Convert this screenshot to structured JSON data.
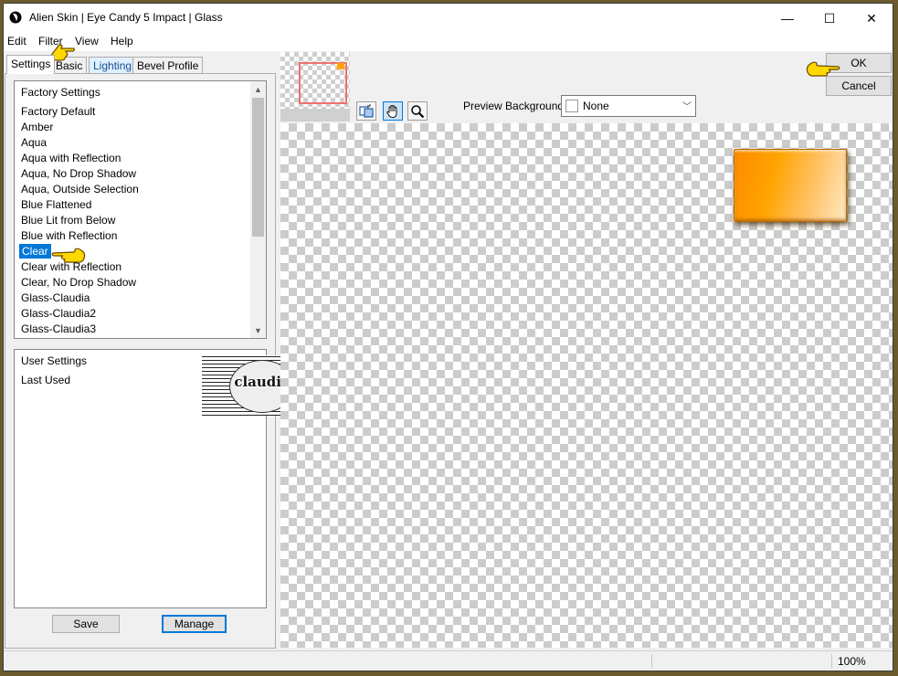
{
  "window": {
    "title": "Alien Skin | Eye Candy 5 Impact | Glass"
  },
  "titlebar_buttons": {
    "minimize": "—",
    "maximize": "☐",
    "close": "✕"
  },
  "menu": [
    "Edit",
    "Filter",
    "View",
    "Help"
  ],
  "tabs": [
    {
      "label": "Settings",
      "active": true
    },
    {
      "label": "Basic",
      "active": false
    },
    {
      "label": "Lighting",
      "active": false
    },
    {
      "label": "Bevel Profile",
      "active": false
    }
  ],
  "preset_list": {
    "items": [
      "Factory Settings",
      "Factory Default",
      "Amber",
      "Aqua",
      "Aqua with Reflection",
      "Aqua, No Drop Shadow",
      "Aqua, Outside Selection",
      "Blue Flattened",
      "Blue Lit from Below",
      "Blue with Reflection",
      "Clear",
      "Clear with Reflection",
      "Clear, No Drop Shadow",
      "Glass-Claudia",
      "Glass-Claudia2",
      "Glass-Claudia3"
    ],
    "selected": "Clear"
  },
  "user_list": {
    "items": [
      "User Settings",
      "Last Used"
    ]
  },
  "buttons": {
    "save": "Save",
    "manage": "Manage",
    "ok": "OK",
    "cancel": "Cancel"
  },
  "preview_background": {
    "label": "Preview Background:",
    "value": "None"
  },
  "tools": [
    "preview-toggle-icon",
    "hand-icon",
    "zoom-icon"
  ],
  "watermark_text": "claudia",
  "status": {
    "zoom": "100%"
  },
  "colors": {
    "selection": "#0078d7",
    "glass": "#ffa400",
    "pointer": "#ffd800"
  }
}
